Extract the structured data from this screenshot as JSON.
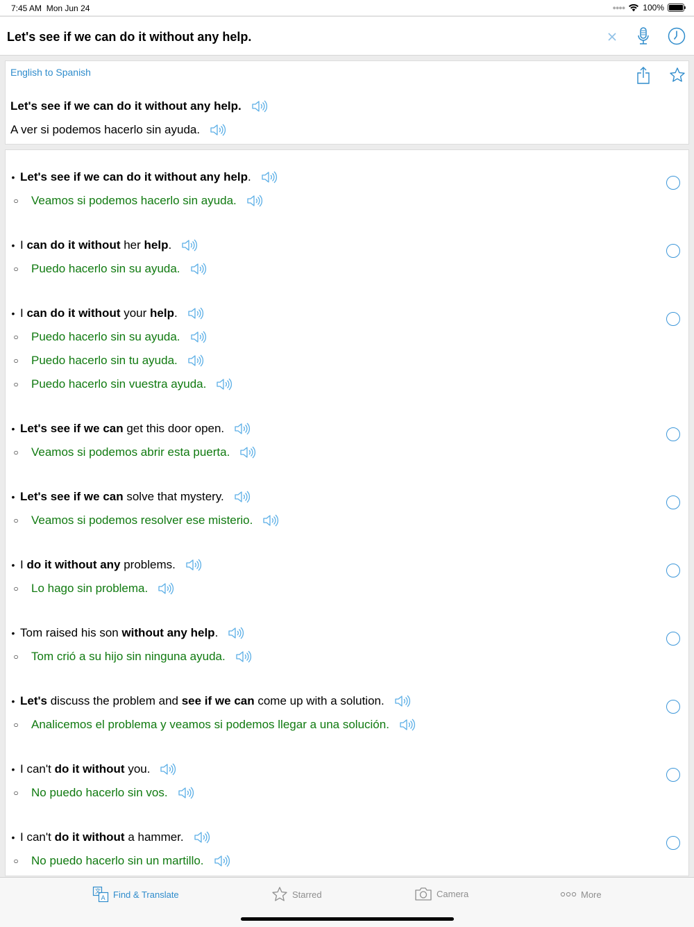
{
  "status": {
    "time": "7:45 AM",
    "date": "Mon Jun 24",
    "battery": "100%"
  },
  "search": {
    "value": "Let's see if we can do it without any help."
  },
  "translation": {
    "language_pair": "English to Spanish",
    "source": "Let's see if we can do it without any help.",
    "target": "A ver si podemos hacerlo sin ayuda."
  },
  "examples": [
    {
      "en": [
        [
          "b",
          "Let's see if we can do it without any help"
        ],
        [
          "t",
          "."
        ]
      ],
      "es": [
        "Veamos si podemos hacerlo sin ayuda."
      ]
    },
    {
      "en": [
        [
          "t",
          "I "
        ],
        [
          "b",
          "can do it without"
        ],
        [
          "t",
          " her "
        ],
        [
          "b",
          "help"
        ],
        [
          "t",
          "."
        ]
      ],
      "es": [
        "Puedo hacerlo sin su ayuda."
      ]
    },
    {
      "en": [
        [
          "t",
          "I "
        ],
        [
          "b",
          "can do it without"
        ],
        [
          "t",
          " your "
        ],
        [
          "b",
          "help"
        ],
        [
          "t",
          "."
        ]
      ],
      "es": [
        "Puedo hacerlo sin su ayuda.",
        "Puedo hacerlo sin tu ayuda.",
        "Puedo hacerlo sin vuestra ayuda."
      ]
    },
    {
      "en": [
        [
          "b",
          "Let's see if we can"
        ],
        [
          "t",
          " get this door open."
        ]
      ],
      "es": [
        "Veamos si podemos abrir esta puerta."
      ]
    },
    {
      "en": [
        [
          "b",
          "Let's see if we can"
        ],
        [
          "t",
          " solve that mystery."
        ]
      ],
      "es": [
        "Veamos si podemos resolver ese misterio."
      ]
    },
    {
      "en": [
        [
          "t",
          "I "
        ],
        [
          "b",
          "do it without any"
        ],
        [
          "t",
          " problems."
        ]
      ],
      "es": [
        "Lo hago sin problema."
      ]
    },
    {
      "en": [
        [
          "t",
          "Tom raised his son "
        ],
        [
          "b",
          "without any help"
        ],
        [
          "t",
          "."
        ]
      ],
      "es": [
        "Tom crió a su hijo sin ninguna ayuda."
      ]
    },
    {
      "en": [
        [
          "b",
          "Let's"
        ],
        [
          "t",
          " discuss the problem and "
        ],
        [
          "b",
          "see if we can"
        ],
        [
          "t",
          " come up with a solution."
        ]
      ],
      "es": [
        "Analicemos el problema y veamos si podemos llegar a una solución."
      ]
    },
    {
      "en": [
        [
          "t",
          "I can't "
        ],
        [
          "b",
          "do it without"
        ],
        [
          "t",
          " you."
        ]
      ],
      "es": [
        "No puedo hacerlo sin vos."
      ]
    },
    {
      "en": [
        [
          "t",
          "I can't "
        ],
        [
          "b",
          "do it without"
        ],
        [
          "t",
          " a hammer."
        ]
      ],
      "es": [
        "No puedo hacerlo sin un martillo."
      ]
    }
  ],
  "tabs": [
    {
      "label": "Find & Translate",
      "icon": "translate-icon",
      "active": true
    },
    {
      "label": "Starred",
      "icon": "star-icon",
      "active": false
    },
    {
      "label": "Camera",
      "icon": "camera-icon",
      "active": false
    },
    {
      "label": "More",
      "icon": "more-icon",
      "active": false
    }
  ],
  "colors": {
    "accent": "#2f8ccc",
    "translation_green": "#107a10",
    "inactive_tab": "#8e8e8e"
  }
}
